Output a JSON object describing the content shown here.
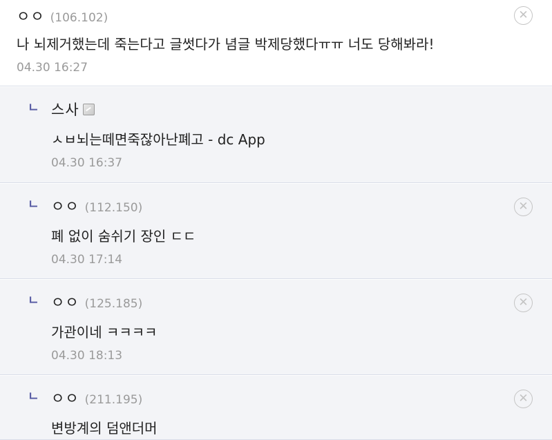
{
  "icons": {
    "reply_marker": "ㄴ",
    "delete_glyph": "✕",
    "memo_icon": "memo-icon"
  },
  "colors": {
    "reply_bg": "#f3f4f7",
    "marker": "#5b5fa6",
    "meta_text": "#9a9a9a",
    "divider": "#d9dde8"
  },
  "comments": [
    {
      "nick": "ㅇㅇ",
      "ip": "(106.102)",
      "text": "나 뇌제거했는데 죽는다고 글썻다가 념글 박제당했다ㅠㅠ 너도 당해봐라!",
      "date": "04.30 16:27"
    },
    {
      "nick": "스사",
      "ip": "",
      "text": "ㅅㅂ뇌는떼면죽잖아난폐고 - dc App",
      "date": "04.30 16:37"
    },
    {
      "nick": "ㅇㅇ",
      "ip": "(112.150)",
      "text": "폐 없이 숨쉬기 장인 ㄷㄷ",
      "date": "04.30 17:14"
    },
    {
      "nick": "ㅇㅇ",
      "ip": "(125.185)",
      "text": "가관이네 ㅋㅋㅋㅋ",
      "date": "04.30 18:13"
    },
    {
      "nick": "ㅇㅇ",
      "ip": "(211.195)",
      "text": "변방계의 덤앤더머",
      "date": ""
    }
  ]
}
